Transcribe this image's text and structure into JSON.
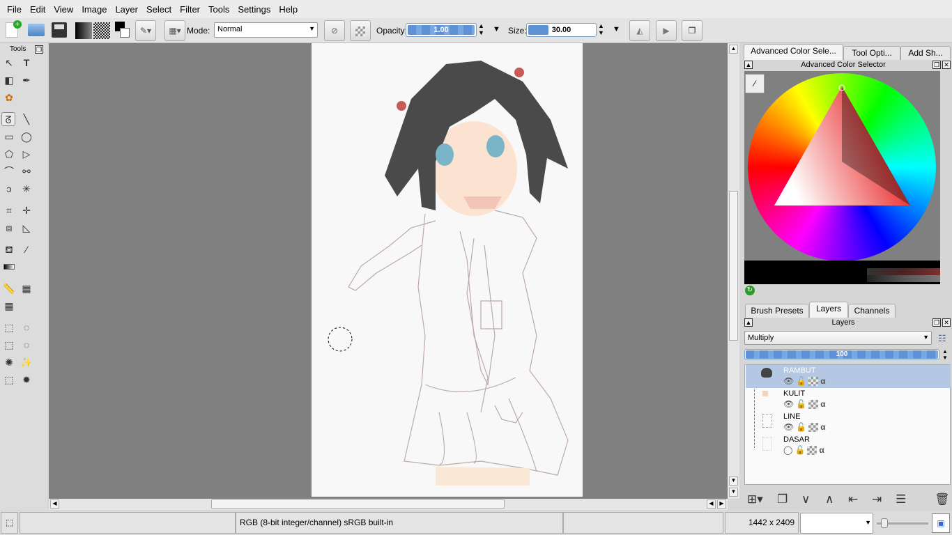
{
  "menu": [
    "File",
    "Edit",
    "View",
    "Image",
    "Layer",
    "Select",
    "Filter",
    "Tools",
    "Settings",
    "Help"
  ],
  "toolbar": {
    "mode_label": "Mode:",
    "mode_value": "Normal",
    "opacity_label": "Opacity:",
    "opacity_value": "1.00",
    "opacity_fraction": 1.0,
    "size_label": "Size:",
    "size_value": "30.00",
    "size_fraction": 0.3
  },
  "tools_docker": {
    "title": "Tools"
  },
  "right_panel": {
    "top_tabs": [
      "Advanced Color Sele...",
      "Tool Opti...",
      "Add Sh..."
    ],
    "color_selector_title": "Advanced Color Selector",
    "bottom_tabs": [
      "Brush Presets",
      "Layers",
      "Channels"
    ],
    "layers_title": "Layers",
    "blend_mode": "Multiply",
    "opacity_value": "100",
    "layers": [
      {
        "name": "RAMBUT",
        "visible": true,
        "selected": true
      },
      {
        "name": "KULIT",
        "visible": true,
        "selected": false
      },
      {
        "name": "LINE",
        "visible": true,
        "selected": false
      },
      {
        "name": "DASAR",
        "visible": false,
        "selected": false
      }
    ]
  },
  "status": {
    "color_space": "RGB (8-bit integer/channel)  sRGB built-in",
    "dimensions": "1442 x 2409"
  },
  "colors": {
    "canvas_bg": "#808080",
    "selection": "#b4c8e4",
    "accent": "#5d93d6",
    "hair": "#4a4a4a"
  }
}
